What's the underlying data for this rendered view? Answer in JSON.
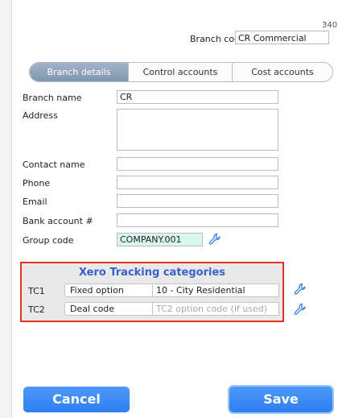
{
  "header": {
    "record_number": "340",
    "branch_code_label": "Branch code",
    "branch_code_value": "CR Commercial"
  },
  "tabs": [
    {
      "label": "Branch details",
      "active": true
    },
    {
      "label": "Control accounts",
      "active": false
    },
    {
      "label": "Cost accounts",
      "active": false
    }
  ],
  "form": {
    "branch_name": {
      "label": "Branch name",
      "value": "CR"
    },
    "address": {
      "label": "Address",
      "value": ""
    },
    "contact_name": {
      "label": "Contact name",
      "value": ""
    },
    "phone": {
      "label": "Phone",
      "value": ""
    },
    "email": {
      "label": "Email",
      "value": ""
    },
    "bank_account": {
      "label": "Bank account #",
      "value": ""
    },
    "group_code": {
      "label": "Group code",
      "value": "COMPANY.001",
      "icon": "wrench-icon"
    }
  },
  "xero": {
    "title": "Xero Tracking categories",
    "rows": [
      {
        "label": "TC1",
        "select": "Fixed option",
        "value": "10 - City Residential",
        "placeholder": ""
      },
      {
        "label": "TC2",
        "select": "Deal code",
        "value": "",
        "placeholder": "TC2 option code (if used)"
      }
    ]
  },
  "buttons": {
    "cancel": "Cancel",
    "save": "Save"
  },
  "colors": {
    "accent": "#2f7ff1",
    "highlight_border": "#e0321e",
    "xero_title": "#3a5fcd",
    "group_code_bg": "#d9f6f0",
    "tab_active": "#8a9db8"
  }
}
